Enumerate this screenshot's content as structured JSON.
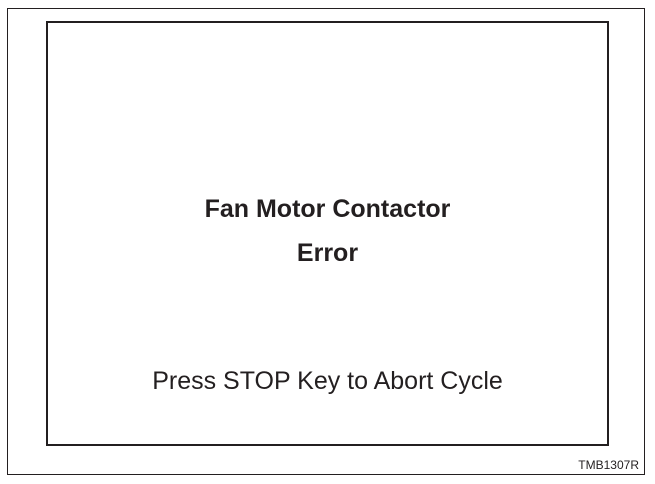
{
  "display": {
    "error_line1": "Fan Motor Contactor",
    "error_line2": "Error",
    "prompt": "Press STOP Key to Abort Cycle"
  },
  "figure_code": "TMB1307R"
}
